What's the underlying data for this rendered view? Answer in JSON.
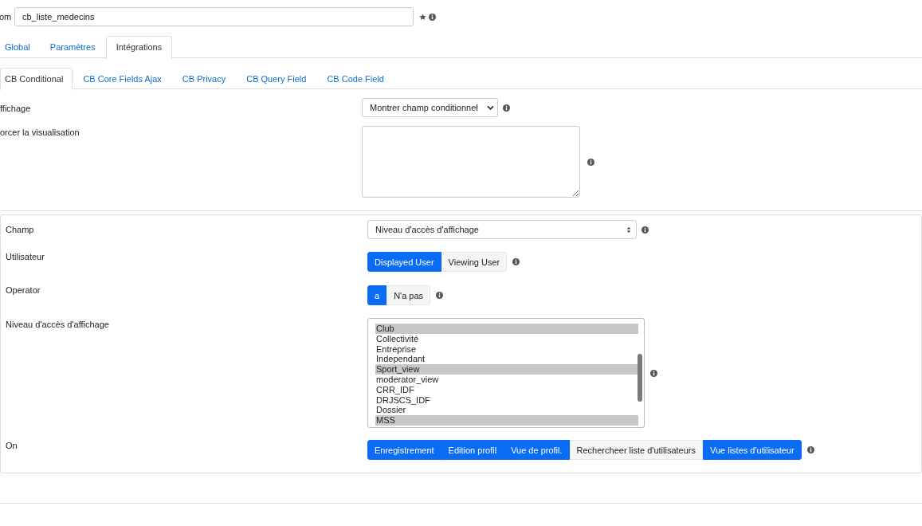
{
  "name_field": {
    "label": "om",
    "value": "cb_liste_medecins"
  },
  "tabs": [
    {
      "label": "Global",
      "selected": false
    },
    {
      "label": "Paramètres",
      "selected": false
    },
    {
      "label": "Intégrations",
      "selected": true
    }
  ],
  "subtabs": [
    {
      "label": "CB Conditional",
      "selected": true
    },
    {
      "label": "CB Core Fields Ajax",
      "selected": false
    },
    {
      "label": "CB Privacy",
      "selected": false
    },
    {
      "label": "CB Query Field",
      "selected": false
    },
    {
      "label": "CB Code Field",
      "selected": false
    }
  ],
  "display": {
    "label": "ffichage",
    "value": "Montrer champ conditionnel"
  },
  "force_view": {
    "label": "orcer la visualisation"
  },
  "condition": {
    "field": {
      "label": "Champ",
      "value": "Niveau d'accès d'affichage"
    },
    "user": {
      "label": "Utilisateur",
      "options": [
        {
          "label": "Displayed User",
          "selected": true
        },
        {
          "label": "Viewing User",
          "selected": false
        }
      ]
    },
    "operator": {
      "label": "Operator",
      "options": [
        {
          "label": "a",
          "selected": true
        },
        {
          "label": "N'a pas",
          "selected": false
        }
      ]
    },
    "levels": {
      "label": "Niveau d'accès d'affichage",
      "options": [
        {
          "label": "Club",
          "selected": true
        },
        {
          "label": "Collectivité",
          "selected": false
        },
        {
          "label": "Entreprise",
          "selected": false
        },
        {
          "label": "Independant",
          "selected": false
        },
        {
          "label": "Sport_view",
          "selected": true
        },
        {
          "label": "moderator_view",
          "selected": false
        },
        {
          "label": "CRR_IDF",
          "selected": false
        },
        {
          "label": "DRJSCS_IDF",
          "selected": false
        },
        {
          "label": "Dossier",
          "selected": false
        },
        {
          "label": "MSS",
          "selected": true
        }
      ]
    },
    "on": {
      "label": "On",
      "options": [
        {
          "label": "Enregistrement",
          "selected": true
        },
        {
          "label": "Edition profil",
          "selected": true
        },
        {
          "label": "Vue de profil.",
          "selected": true
        },
        {
          "label": "Rechercheer liste d'utilisateurs",
          "selected": false
        },
        {
          "label": "Vue listes d'utilisateur",
          "selected": true
        }
      ]
    }
  }
}
